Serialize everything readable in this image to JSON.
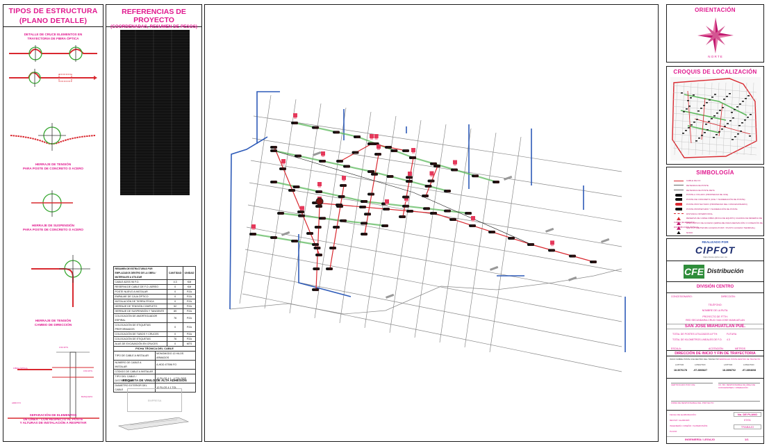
{
  "left": {
    "title_line1": "TIPOS DE ESTRUCTURA",
    "title_line2": "(PLANO DETALLE)",
    "cap1a": "DETALLE DE CRUCE ELEMENTOS EN",
    "cap1b": "TRAYECTORIA DE FIBRA ÓPTICA",
    "cap2a": "HERRAJE DE TENSIÓN",
    "cap2b": "PARA POSTE DE CONCRETO O ACERO",
    "cap3a": "HERRAJE DE SUSPENSIÓN",
    "cap3b": "PARA POSTE DE CONCRETO O ACERO",
    "cap4a": "HERRAJE DE TENSIÓN",
    "cap4b": "CAMBIO DE DIRECCIÓN",
    "cap5a": "SEPARACIÓN DE ELEMENTOS",
    "cap5b": "DE LÍNEA - CON RESPECTO AL POSTE",
    "cap5c": "Y ALTURAS DE INSTALACIÓN A RESPETAR",
    "dim1": "0.50 MTS",
    "dim2": "0.50 MTS",
    "lbl_fibra": "FIBRA ÓPTICA",
    "lbl_banqueta": "BANQUETA",
    "lbl_arroyo": "ARROYO"
  },
  "refs": {
    "title": "REFERENCIAS DE PROYECTO",
    "subtitle": "(COORDENADAS, RESUMEN DE PESOS)",
    "materials_header": "RESUMEN DE ESTRUCTURAS POR EMPLAZADOS DENTRO DE LA OBRA / MATERIALES A UTILIZAR",
    "col_qty": "CANTIDAD",
    "col_unit": "UNIDAD",
    "materials": [
      {
        "name": "CABLE ADSS 96 F.O.",
        "qty": "4.3",
        "unit": "KM"
      },
      {
        "name": "RESERVA DE CABLE DE F.O. AEREO",
        "qty": "0",
        "unit": "KM"
      },
      {
        "name": "POSTE NUEVO A INSTALAR",
        "qty": "0",
        "unit": "PZA"
      },
      {
        "name": "EMPALME DE CAJA ÓPTICO",
        "qty": "0",
        "unit": "PZA"
      },
      {
        "name": "INSTALACIÓN DE TIERRA FÍSICA",
        "qty": "0",
        "unit": "PZA"
      },
      {
        "name": "HERRAJE DE TENSIÓN COMPLETO",
        "qty": "52",
        "unit": "PZA"
      },
      {
        "name": "HERRAJE DE SUSPENSIÓN Y TANGENTE",
        "qty": "89",
        "unit": "PZA"
      },
      {
        "name": "COLOCACIÓN DE AMORTIGUADOR ESPIRAL",
        "qty": "76",
        "pz": "",
        "unit": "PZA"
      },
      {
        "name": "COLOCACIÓN DE ETIQUETAS PREFORMADOS",
        "qty": "0",
        "unit": "PZA"
      },
      {
        "name": "COLOCACIÓN DE TUBOS Y CRUCES",
        "qty": "0",
        "unit": "PZA"
      },
      {
        "name": "COLOCACIÓN DE ETIQUETAS",
        "qty": "76",
        "unit": "PZA"
      },
      {
        "name": "ALAS DE EXCAVACIÓN EN CRUCES",
        "qty": "0",
        "unit": "MTS"
      }
    ],
    "cable_title": "FICHA TÉCNICA DEL CABLE",
    "cable_rows": [
      {
        "k": "TIPO DE CABLE A INSTALAR",
        "v": "MONOMODO 12 HILOS ARMADOS"
      },
      {
        "k": "NÚMERO DE CABLE A INSTALAR",
        "v": "A-HDD 4TS96 FO"
      },
      {
        "k": "CÓDIGO DE CABLE A INSTALAR",
        "v": ""
      },
      {
        "k": "TIPO DEL CABLE / DISTRIBUIDOR",
        "v": "12 FILOS 4 1 - 4 TOL ROS"
      },
      {
        "k": "DIAMETRO EXTERIOR DEL CABLE",
        "v": "12 FILOS 4 1 TOL"
      }
    ],
    "label_title": "ETIQUETA DE VINILO DE ALTA ADHESIÓN",
    "label_text": "EMPRESA"
  },
  "right": {
    "orient_title": "ORIENTACIÓN",
    "orient_north": "N O R T E",
    "croquis_title": "CROQUIS DE LOCALIZACIÓN",
    "simb_title": "SIMBOLOGÍA",
    "symbols": [
      "CABLE DE FO",
      "RETENIDA DE POSTE",
      "RETENIDA DE POSTE RETA",
      "POSTE A VOLADO (PROPIEDAD DE CFE)",
      "POSTE DE CONCRETO (CFE Y NUMERACIÓN DE POSTE)",
      "POSTE PROYECTADO (PROPIEDAD DEL CONCESIONARIO)",
      "POSTE PROPIETARIO Y NUMERACIÓN DE POSTE",
      "DISTANCIA INTERPOSTAL",
      "RESERVA DE CABLE FIBRA (BOCA DE EQUIPO) CUADRA DE RESERVA DE CABLE (ELEMENTO)",
      "DISPOSITIVO DE ACCESO (EMPALME PARA DERIVACIÓN O CONEXIÓN DE DISTRIBUCIÓN ÓPTICA)",
      "NAP PUT (NETWORK ACCESS POINT / PUNTO ACCESO TERMINAL)",
      "NODO"
    ],
    "made_by": "REALIZADO POR",
    "cipfot": "CIPFOT",
    "cipfot_sub": "https://www.cipfot.com.mx",
    "cfe": "CFE",
    "distribucion": "Distribución",
    "division": "DIVISIÓN CENTRO",
    "concesionario": "CONCESIONARIO:",
    "direccion": "DIRECCIÓN:",
    "telefono": "TELÉFONO:",
    "nombre_ruta": "NOMBRE DE LA RUTA:",
    "proyecto": "PROYECTO DE FTTH:",
    "proyecto_val": "RED SECUNDARIA CRUCI SAN JOSE MIAHUATLAN",
    "municipio": "SAN JOSE MIAHUATLAN PUE.",
    "total_postes": "TOTAL DE POSTES UTILIZADOS A FTH:",
    "total_postes_val": "FUTURA",
    "total_km": "TOTAL DE KILOMETROS LINEALES DE F.O.",
    "total_km_val": "4.3",
    "escala": "ESCALA:",
    "acotacion": "ACOTACIÓN:",
    "acotacion_val": "METROS",
    "dir_title": "DIRECCIÓN DE INICIO Y FIN DE TRAYECTORIA",
    "inicio_lbl": "INICIO SOBRE POSTE CFE DENTRO DEL TRAYECTO",
    "fin_lbl": "TERMINA EN POSTE DENTRO DE TRAYECTO",
    "lat": "LATITUD",
    "lon": "LONGITUD",
    "lat1": "18.3076178",
    "lon1": "-97.2806827",
    "lat2": "18.2898702",
    "lon2": "-97.2894608",
    "certificado": "CERTIFICADO POR CFE",
    "vo": "VO. BO. RESPONSABLE DE ÁREA DE CONCESIONES / OPERACIÓN",
    "firma": "FIRMA DE RESPONSABLE DEL PROYECTO",
    "f1": "FECHA DE ELABORACIÓN:",
    "f2": "REVISÓ / ELABORÓ:",
    "f3": "INGENIERÍA / DISEÑO / SUPERVISIÓN:",
    "f4": "PLANO:",
    "no_plano": "No. DE PLANO",
    "no_plano_val": "07/01",
    "trabajo": "TRABAJO",
    "ingenieria": "INGENIERÍA / LEGAJO",
    "hoja": "1/1"
  }
}
